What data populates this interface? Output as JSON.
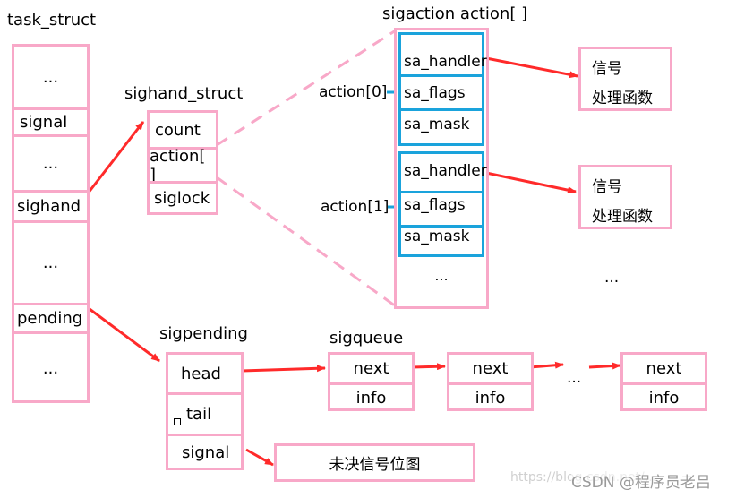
{
  "task_struct": {
    "title": "task_struct",
    "fields": [
      "...",
      "signal",
      "...",
      "sighand",
      "...",
      "pending",
      "..."
    ]
  },
  "sighand_struct": {
    "title": "sighand_struct",
    "fields": [
      "count",
      "action[ ]",
      "siglock"
    ]
  },
  "sigaction_array": {
    "title": "sigaction action[ ]",
    "entries": [
      {
        "label": "action[0]",
        "fields": [
          "sa_handler",
          "sa_flags",
          "sa_mask"
        ]
      },
      {
        "label": "action[1]",
        "fields": [
          "sa_handler",
          "sa_flags",
          "sa_mask"
        ]
      }
    ],
    "more": "..."
  },
  "handlers": [
    {
      "line1": "信号",
      "line2": "处理函数"
    },
    {
      "line1": "信号",
      "line2": "处理函数"
    }
  ],
  "handlers_more": "...",
  "sigpending": {
    "title": "sigpending",
    "fields": [
      "head",
      "tail",
      "signal"
    ]
  },
  "sigqueue": {
    "title": "sigqueue",
    "nodes": [
      {
        "next": "next",
        "info": "info"
      },
      {
        "next": "next",
        "info": "info"
      },
      {
        "next": "next",
        "info": "info"
      }
    ],
    "ellipsis": "..."
  },
  "bitmap": {
    "label": "未决信号位图"
  },
  "colors": {
    "struct_border": "#f8a8c8",
    "sigaction_border": "#1aa3dc",
    "arrow": "#ff2a2a"
  },
  "watermark": {
    "url": "https://blog.csdn.net/...",
    "brand": "CSDN @程序员老吕"
  }
}
